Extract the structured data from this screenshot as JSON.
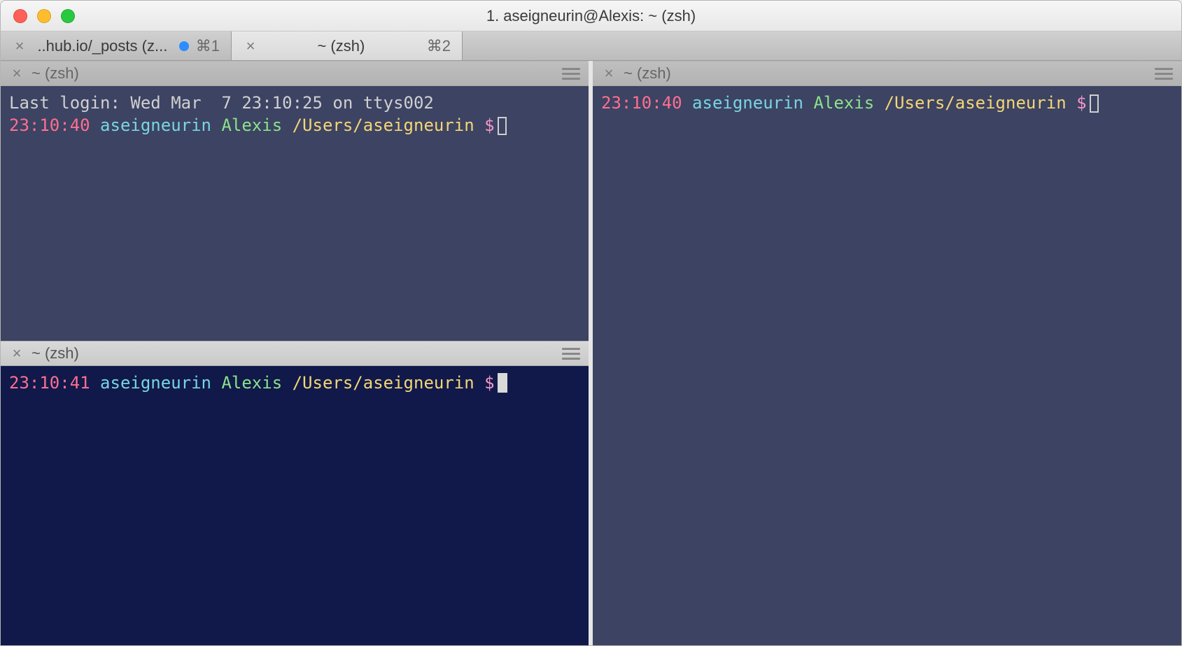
{
  "window": {
    "title": "1. aseigneurin@Alexis: ~ (zsh)"
  },
  "tabs": [
    {
      "label": "..hub.io/_posts (z...",
      "shortcut": "⌘1",
      "modified": true,
      "active": false
    },
    {
      "label": "~ (zsh)",
      "shortcut": "⌘2",
      "modified": false,
      "active": true
    }
  ],
  "panes": {
    "topLeft": {
      "title": "~ (zsh)",
      "headerActive": false,
      "theme": "a",
      "lastLogin": "Last login: Wed Mar  7 23:10:25 on ttys002",
      "prompt": {
        "time": "23:10:40",
        "user": "aseigneurin",
        "host": "Alexis",
        "path": "/Users/aseigneurin",
        "symbol": "$",
        "cursor": "outline"
      }
    },
    "bottomLeft": {
      "title": "~ (zsh)",
      "headerActive": true,
      "theme": "b",
      "prompt": {
        "time": "23:10:41",
        "user": "aseigneurin",
        "host": "Alexis",
        "path": "/Users/aseigneurin",
        "symbol": "$",
        "cursor": "block"
      }
    },
    "right": {
      "title": "~ (zsh)",
      "headerActive": false,
      "theme": "a",
      "prompt": {
        "time": "23:10:40",
        "user": "aseigneurin",
        "host": "Alexis",
        "path": "/Users/aseigneurin",
        "symbol": "$",
        "cursor": "outline"
      }
    }
  }
}
